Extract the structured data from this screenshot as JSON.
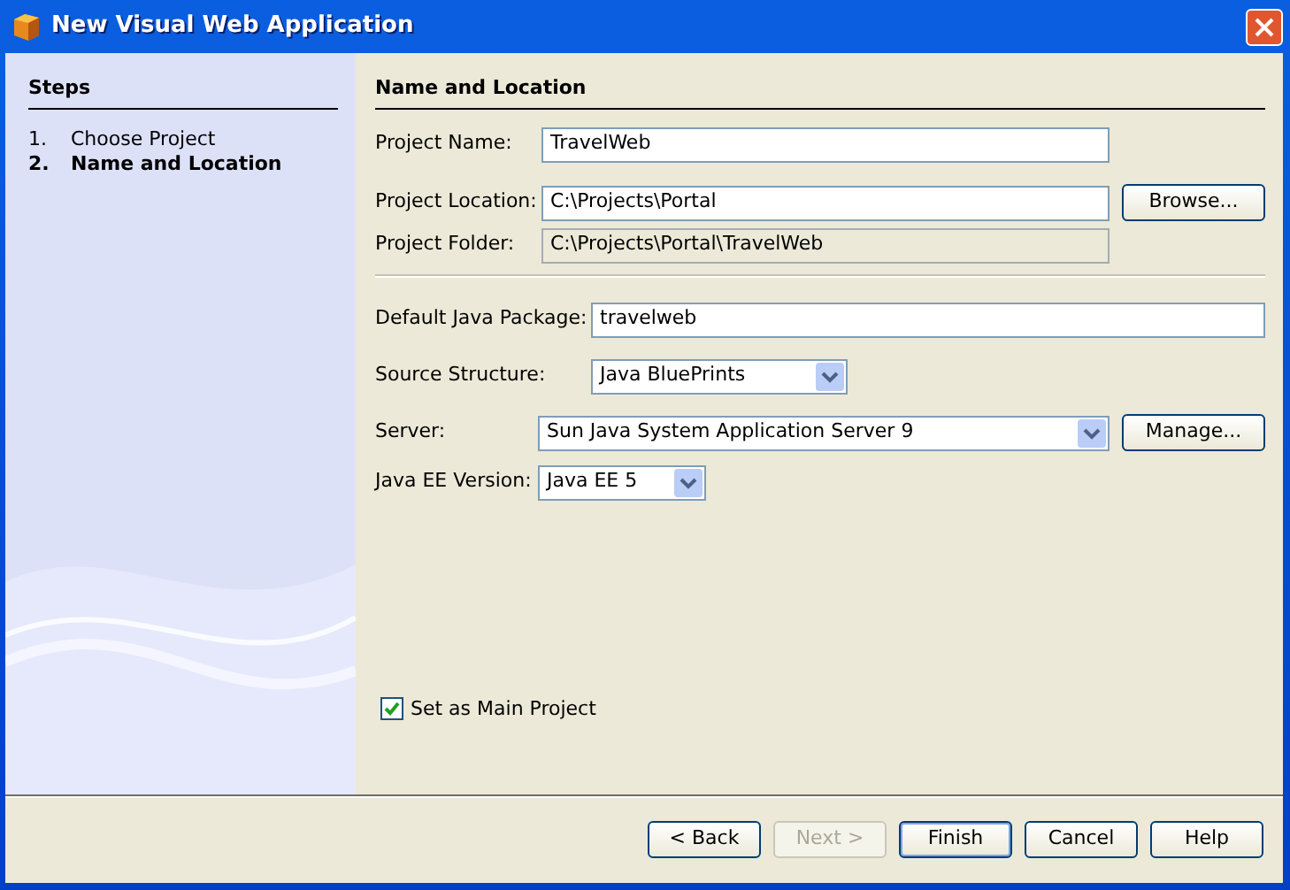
{
  "window": {
    "title": "New Visual Web Application"
  },
  "steps": {
    "title": "Steps",
    "items": [
      {
        "number": "1.",
        "label": "Choose Project",
        "selected": false
      },
      {
        "number": "2.",
        "label": "Name and Location",
        "selected": true
      }
    ]
  },
  "panel": {
    "title": "Name and Location",
    "groups": [
      [
        {
          "label": "Project Name:",
          "kind": "text",
          "value": "TravelWeb"
        },
        {
          "label": "Project Location:",
          "kind": "text",
          "value": "C:\\Projects\\Portal",
          "button": "Browse..."
        },
        {
          "label": "Project Folder:",
          "kind": "readonly",
          "value": "C:\\Projects\\Portal\\TravelWeb"
        }
      ],
      [
        {
          "label": "Default Java Package:",
          "kind": "text",
          "value": "travelweb"
        },
        {
          "label": "Source Structure:",
          "kind": "select",
          "value": "Java BluePrints"
        },
        {
          "label": "Server:",
          "kind": "select",
          "value": "Sun Java System Application Server 9",
          "button": "Manage..."
        },
        {
          "label": "Java EE Version:",
          "kind": "select",
          "value": "Java EE 5"
        }
      ]
    ],
    "checkbox": {
      "label": "Set as Main Project",
      "checked": true
    }
  },
  "buttons": [
    {
      "label": "< Back",
      "disabled": false,
      "default": false
    },
    {
      "label": "Next >",
      "disabled": true,
      "default": false
    },
    {
      "label": "Finish",
      "disabled": false,
      "default": true
    },
    {
      "label": "Cancel",
      "disabled": false,
      "default": false
    },
    {
      "label": "Help",
      "disabled": false,
      "default": false
    }
  ]
}
